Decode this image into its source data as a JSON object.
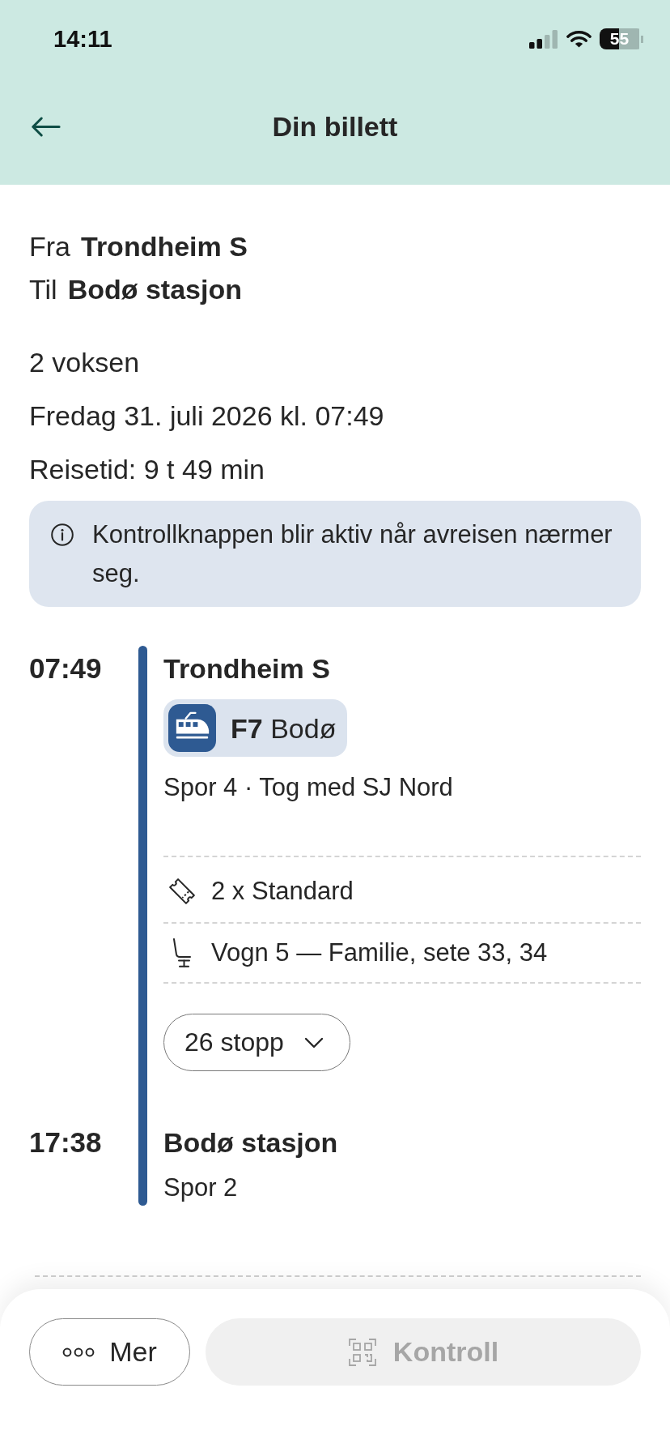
{
  "status_bar": {
    "time": "14:11",
    "battery": "55"
  },
  "header": {
    "title": "Din billett"
  },
  "route": [
    {
      "label": "Fra",
      "station": "Trondheim S"
    },
    {
      "label": "Til",
      "station": "Bodø stasjon"
    }
  ],
  "details": [
    "2 voksen",
    "Fredag 31. juli 2026 kl. 07:49",
    "Reisetid: 9 t 49 min"
  ],
  "notice": {
    "text": "Kontrollknappen blir aktiv når avreisen nærmer seg."
  },
  "journey": {
    "departure": {
      "time": "07:49",
      "station": "Trondheim S",
      "info": "Spor 4 · Tog med SJ Nord"
    },
    "train": {
      "label": "**F7** Bodø"
    },
    "items": [
      {
        "kind": "ticket",
        "text": "2 x Standard"
      },
      {
        "kind": "seat",
        "text": "Vogn 5 — Familie, sete 33, 34"
      }
    ],
    "stops_button": {
      "label": "26 stopp",
      "expanded": false
    },
    "arrival": {
      "time": "17:38",
      "station": "Bodø stasjon",
      "info": "Spor 2"
    }
  },
  "actions": [
    {
      "kind": "more",
      "label": "Mer",
      "disabled": false
    },
    {
      "kind": "qr",
      "label": "Kontroll",
      "disabled": true
    }
  ]
}
